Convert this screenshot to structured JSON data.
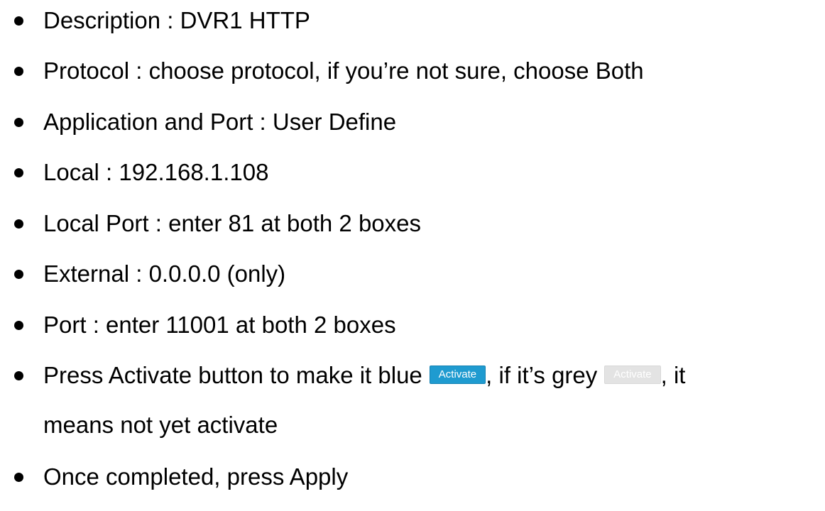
{
  "steps": [
    {
      "text": "Description : DVR1 HTTP"
    },
    {
      "text": "Protocol : choose protocol, if you’re not sure, choose Both"
    },
    {
      "text": "Application and Port : User Define"
    },
    {
      "text": "Local : 192.168.1.108"
    },
    {
      "text": "Local Port : enter 81 at both 2 boxes"
    },
    {
      "text": "External : 0.0.0.0  (only)"
    },
    {
      "text": "Port : enter 11001 at both 2 boxes"
    },
    {
      "text_before": "Press Activate button to make it blue",
      "button_active_label": "Activate",
      "text_middle": ", if it’s grey",
      "button_inactive_label": "Activate",
      "text_after": ", it",
      "text_line2": "means not yet activate"
    },
    {
      "text": "Once completed, press Apply"
    }
  ],
  "colors": {
    "activate_blue": "#1f9bd0",
    "activate_grey": "#e3e3e3"
  }
}
